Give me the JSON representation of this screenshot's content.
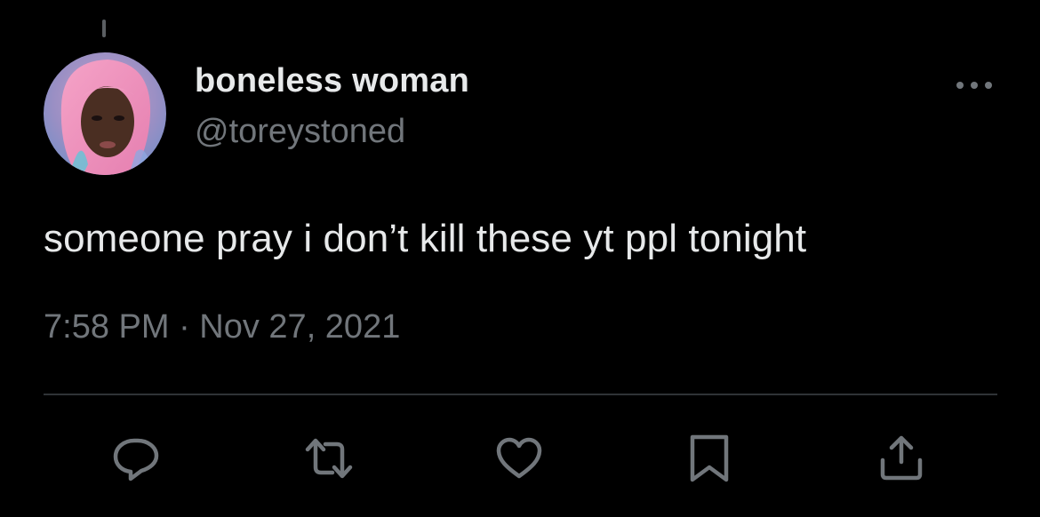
{
  "tweet": {
    "author": {
      "display_name": "boneless woman",
      "handle": "@toreystoned"
    },
    "text": "someone pray i don’t kill these yt ppl tonight",
    "timestamp": "7:58 PM · Nov 27, 2021"
  },
  "icons": {
    "more": "more-horizontal-icon",
    "reply": "reply-icon",
    "retweet": "retweet-icon",
    "like": "heart-icon",
    "bookmark": "bookmark-icon",
    "share": "share-icon"
  },
  "colors": {
    "background": "#000000",
    "primary_text": "#e7e9ea",
    "secondary_text": "#71767b",
    "divider": "#2f3336"
  }
}
